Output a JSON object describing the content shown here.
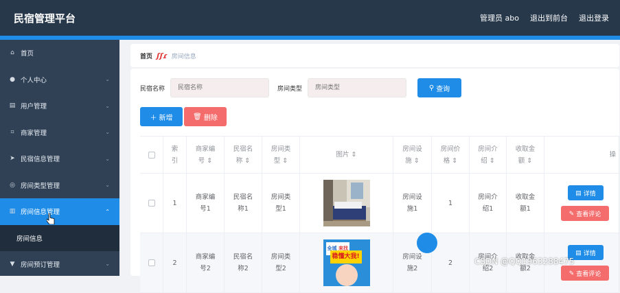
{
  "header": {
    "title": "民宿管理平台",
    "admin_label": "管理员 abo",
    "to_frontend": "退出到前台",
    "logout": "退出登录"
  },
  "sidebar": {
    "items": [
      {
        "label": "首页",
        "icon": "home-icon",
        "glyph": "⌂",
        "has_chevron": false
      },
      {
        "label": "个人中心",
        "icon": "user-icon",
        "glyph": "●",
        "has_chevron": true
      },
      {
        "label": "用户管理",
        "icon": "document-icon",
        "glyph": "▤",
        "has_chevron": true
      },
      {
        "label": "商家管理",
        "icon": "crop-icon",
        "glyph": "⌗",
        "has_chevron": true
      },
      {
        "label": "民宿信息管理",
        "icon": "send-icon",
        "glyph": "➤",
        "has_chevron": true
      },
      {
        "label": "房间类型管理",
        "icon": "compass-icon",
        "glyph": "◎",
        "has_chevron": true
      },
      {
        "label": "房间信息管理",
        "icon": "chart-icon",
        "glyph": "▥",
        "has_chevron": true,
        "active": true
      }
    ],
    "submenu_item": "房间信息",
    "last_item": {
      "label": "房间预订管理",
      "icon": "bookmark-icon",
      "glyph": "▼"
    }
  },
  "breadcrumb": {
    "home": "首页",
    "separator": "ʃʃɾ",
    "current": "房间信息"
  },
  "search": {
    "name_label": "民宿名称",
    "name_placeholder": "民宿名称",
    "type_label": "房间类型",
    "type_placeholder": "房间类型",
    "search_button": "查询"
  },
  "actions": {
    "add_button": "新增",
    "delete_button": "删除"
  },
  "table": {
    "columns": [
      "索\n引",
      "商家编\n号 ⇕",
      "民宿名\n称 ⇕",
      "房间类\n型 ⇕",
      "图片 ⇕",
      "房间设\n施 ⇕",
      "房间价\n格 ⇕",
      "房间介\n绍 ⇕",
      "收取金\n额 ⇕",
      "操"
    ],
    "rows": [
      {
        "index": "1",
        "merchant": "商家编\n号1",
        "homestay": "民宿名\n称1",
        "room_type": "房间类\n型1",
        "facility": "房间设\n施1",
        "price": "1",
        "intro": "房间介\n绍1",
        "amount": "收取金\n额1",
        "detail": "详情",
        "review": "查看评论"
      },
      {
        "index": "2",
        "merchant": "商家编\n号2",
        "homestay": "民宿名\n称2",
        "room_type": "房间类\n型2",
        "facility": "房间设\n施2",
        "price": "2",
        "intro": "房间介\n绍2",
        "amount": "收取金\n额2",
        "detail": "详情",
        "review": "查看评论"
      }
    ],
    "poster_text": [
      "全城",
      "来找",
      "稳",
      "懂大我!"
    ]
  },
  "watermark": "CSDN @QQ1963288475",
  "colors": {
    "header_bg": "#27384b",
    "sidebar_bg": "#304156",
    "accent": "#1f8de8",
    "danger": "#f56c6c"
  }
}
